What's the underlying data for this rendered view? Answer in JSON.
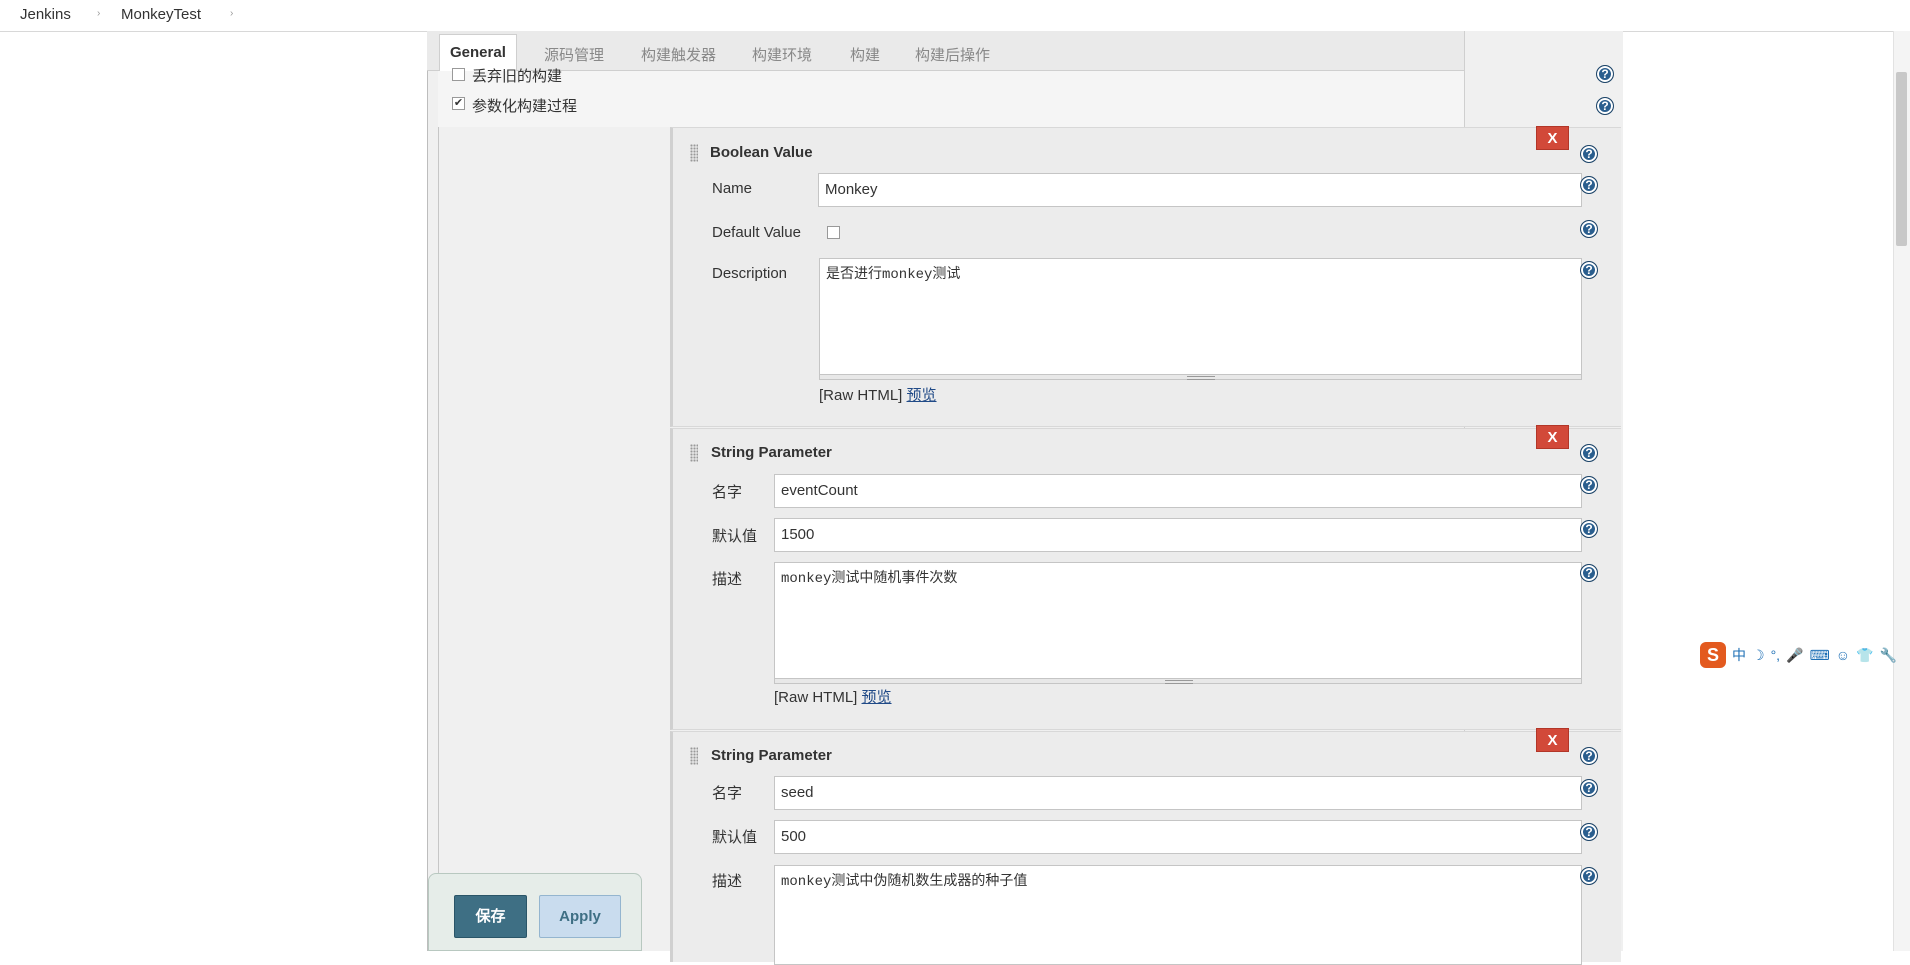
{
  "breadcrumb": {
    "items": [
      "Jenkins",
      "MonkeyTest"
    ],
    "separator": "›"
  },
  "tabs": [
    {
      "label": "General",
      "active": true
    },
    {
      "label": "源码管理"
    },
    {
      "label": "构建触发器"
    },
    {
      "label": "构建环境"
    },
    {
      "label": "构建"
    },
    {
      "label": "构建后操作"
    }
  ],
  "options": {
    "discard_old_builds": {
      "label": "丢弃旧的构建",
      "checked": false
    },
    "parameterized": {
      "label": "参数化构建过程",
      "checked": true
    }
  },
  "params": [
    {
      "type": "Boolean Value",
      "name_label": "Name",
      "name_value": "Monkey",
      "default_label": "Default Value",
      "default_checked": false,
      "desc_label": "Description",
      "desc_value": "是否进行monkey测试",
      "raw_html": "[Raw HTML]",
      "preview": "预览",
      "delete_label": "X"
    },
    {
      "type": "String Parameter",
      "name_label": "名字",
      "name_value": "eventCount",
      "default_label": "默认值",
      "default_value": "1500",
      "desc_label": "描述",
      "desc_value": "monkey测试中随机事件次数",
      "raw_html": "[Raw HTML]",
      "preview": "预览",
      "delete_label": "X"
    },
    {
      "type": "String Parameter",
      "name_label": "名字",
      "name_value": "seed",
      "default_label": "默认值",
      "default_value": "500",
      "desc_label": "描述",
      "desc_value": "monkey测试中伪随机数生成器的种子值",
      "delete_label": "X"
    }
  ],
  "help_label": "?",
  "buttons": {
    "save": "保存",
    "apply": "Apply"
  },
  "ime": {
    "logo": "S",
    "mode": "中",
    "moon": "☽",
    "punct": "°,",
    "mic": "🎤",
    "keyboard": "⌨",
    "person": "☺",
    "shirt": "👕",
    "wrench": "🔧"
  },
  "colors": {
    "delete": "#d24939",
    "help": "#2a5e8e",
    "save": "#3e6f84",
    "link": "#204a87"
  }
}
